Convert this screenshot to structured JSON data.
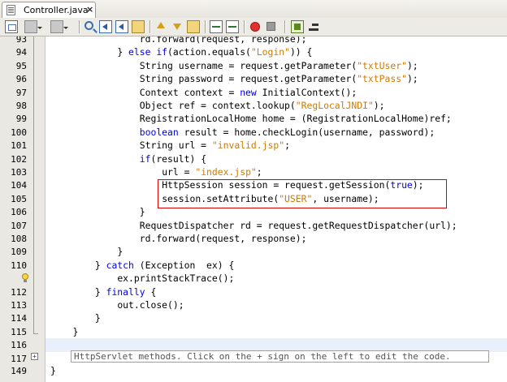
{
  "tab": {
    "label": "Controller.java",
    "close": "×"
  },
  "toolbar": {
    "buttons": [
      "last-edit-icon",
      "back-icon",
      "forward-icon",
      "find-icon",
      "find-previous-icon",
      "find-next-icon",
      "toggle-highlight-icon",
      "previous-bookmark-icon",
      "next-bookmark-icon",
      "toggle-bookmark-icon",
      "shift-left-icon",
      "shift-right-icon",
      "record-macro-icon",
      "stop-macro-icon",
      "run-macro-icon",
      "comment-icon"
    ]
  },
  "colors": {
    "keyword": "#0000e6",
    "string": "#ce7b00",
    "highlight_border": "#d90000",
    "current_line": "#e9effb"
  },
  "editor": {
    "lines": [
      {
        "num": "93",
        "parts": [
          {
            "t": "rd.forward(request, response);",
            "c": ""
          }
        ]
      },
      {
        "num": "94",
        "parts": [
          {
            "t": "} ",
            "c": ""
          },
          {
            "t": "else if",
            "c": "kw"
          },
          {
            "t": "(action.equals(",
            "c": ""
          },
          {
            "t": "\"Login\"",
            "c": "str"
          },
          {
            "t": ")) {",
            "c": ""
          }
        ]
      },
      {
        "num": "95",
        "parts": [
          {
            "t": "String username = request.getParameter(",
            "c": ""
          },
          {
            "t": "\"txtUser\"",
            "c": "str"
          },
          {
            "t": ");",
            "c": ""
          }
        ]
      },
      {
        "num": "96",
        "parts": [
          {
            "t": "String password = request.getParameter(",
            "c": ""
          },
          {
            "t": "\"txtPass\"",
            "c": "str"
          },
          {
            "t": ");",
            "c": ""
          }
        ]
      },
      {
        "num": "97",
        "parts": [
          {
            "t": "Context context = ",
            "c": ""
          },
          {
            "t": "new",
            "c": "kw"
          },
          {
            "t": " InitialContext();",
            "c": ""
          }
        ]
      },
      {
        "num": "98",
        "parts": [
          {
            "t": "Object ref = context.lookup(",
            "c": ""
          },
          {
            "t": "\"RegLocalJNDI\"",
            "c": "str"
          },
          {
            "t": ");",
            "c": ""
          }
        ]
      },
      {
        "num": "99",
        "parts": [
          {
            "t": "RegistrationLocalHome home = (RegistrationLocalHome)ref;",
            "c": ""
          }
        ]
      },
      {
        "num": "100",
        "parts": [
          {
            "t": "boolean",
            "c": "kw"
          },
          {
            "t": " result = home.checkLogin(username, password);",
            "c": ""
          }
        ]
      },
      {
        "num": "101",
        "parts": [
          {
            "t": "String url = ",
            "c": ""
          },
          {
            "t": "\"invalid.jsp\"",
            "c": "str"
          },
          {
            "t": ";",
            "c": ""
          }
        ]
      },
      {
        "num": "102",
        "parts": [
          {
            "t": "if",
            "c": "kw"
          },
          {
            "t": "(result) {",
            "c": ""
          }
        ]
      },
      {
        "num": "103",
        "parts": [
          {
            "t": "url = ",
            "c": ""
          },
          {
            "t": "\"index.jsp\"",
            "c": "str"
          },
          {
            "t": ";",
            "c": ""
          }
        ]
      },
      {
        "num": "104",
        "parts": [
          {
            "t": "HttpSession session = request.getSession(",
            "c": ""
          },
          {
            "t": "true",
            "c": "kw"
          },
          {
            "t": ");",
            "c": ""
          }
        ]
      },
      {
        "num": "105",
        "parts": [
          {
            "t": "session.setAttribute(",
            "c": ""
          },
          {
            "t": "\"USER\"",
            "c": "str"
          },
          {
            "t": ", username);",
            "c": ""
          }
        ]
      },
      {
        "num": "106",
        "parts": [
          {
            "t": "}",
            "c": ""
          }
        ]
      },
      {
        "num": "107",
        "parts": [
          {
            "t": "RequestDispatcher rd = request.getRequestDispatcher(url);",
            "c": ""
          }
        ]
      },
      {
        "num": "108",
        "parts": [
          {
            "t": "rd.forward(request, response);",
            "c": ""
          }
        ]
      },
      {
        "num": "109",
        "parts": [
          {
            "t": "}",
            "c": ""
          }
        ]
      },
      {
        "num": "110",
        "parts": [
          {
            "t": "} ",
            "c": ""
          },
          {
            "t": "catch",
            "c": "kw"
          },
          {
            "t": " (Exception  ex) {",
            "c": ""
          }
        ]
      },
      {
        "num": "",
        "parts": [
          {
            "t": "ex.printStackTrace();",
            "c": ""
          }
        ]
      },
      {
        "num": "112",
        "parts": [
          {
            "t": "} ",
            "c": ""
          },
          {
            "t": "finally",
            "c": "kw"
          },
          {
            "t": " {",
            "c": ""
          }
        ]
      },
      {
        "num": "113",
        "parts": [
          {
            "t": "out.close();",
            "c": ""
          }
        ]
      },
      {
        "num": "114",
        "parts": [
          {
            "t": "}",
            "c": ""
          }
        ]
      },
      {
        "num": "115",
        "parts": [
          {
            "t": "}",
            "c": ""
          }
        ]
      },
      {
        "num": "116",
        "parts": []
      },
      {
        "num": "117",
        "parts": []
      },
      {
        "num": "149",
        "parts": [
          {
            "t": "}",
            "c": ""
          }
        ]
      }
    ],
    "folded_hint": "HttpServlet methods. Click on the + sign on the left to edit the code.",
    "fold_expand": "+"
  }
}
